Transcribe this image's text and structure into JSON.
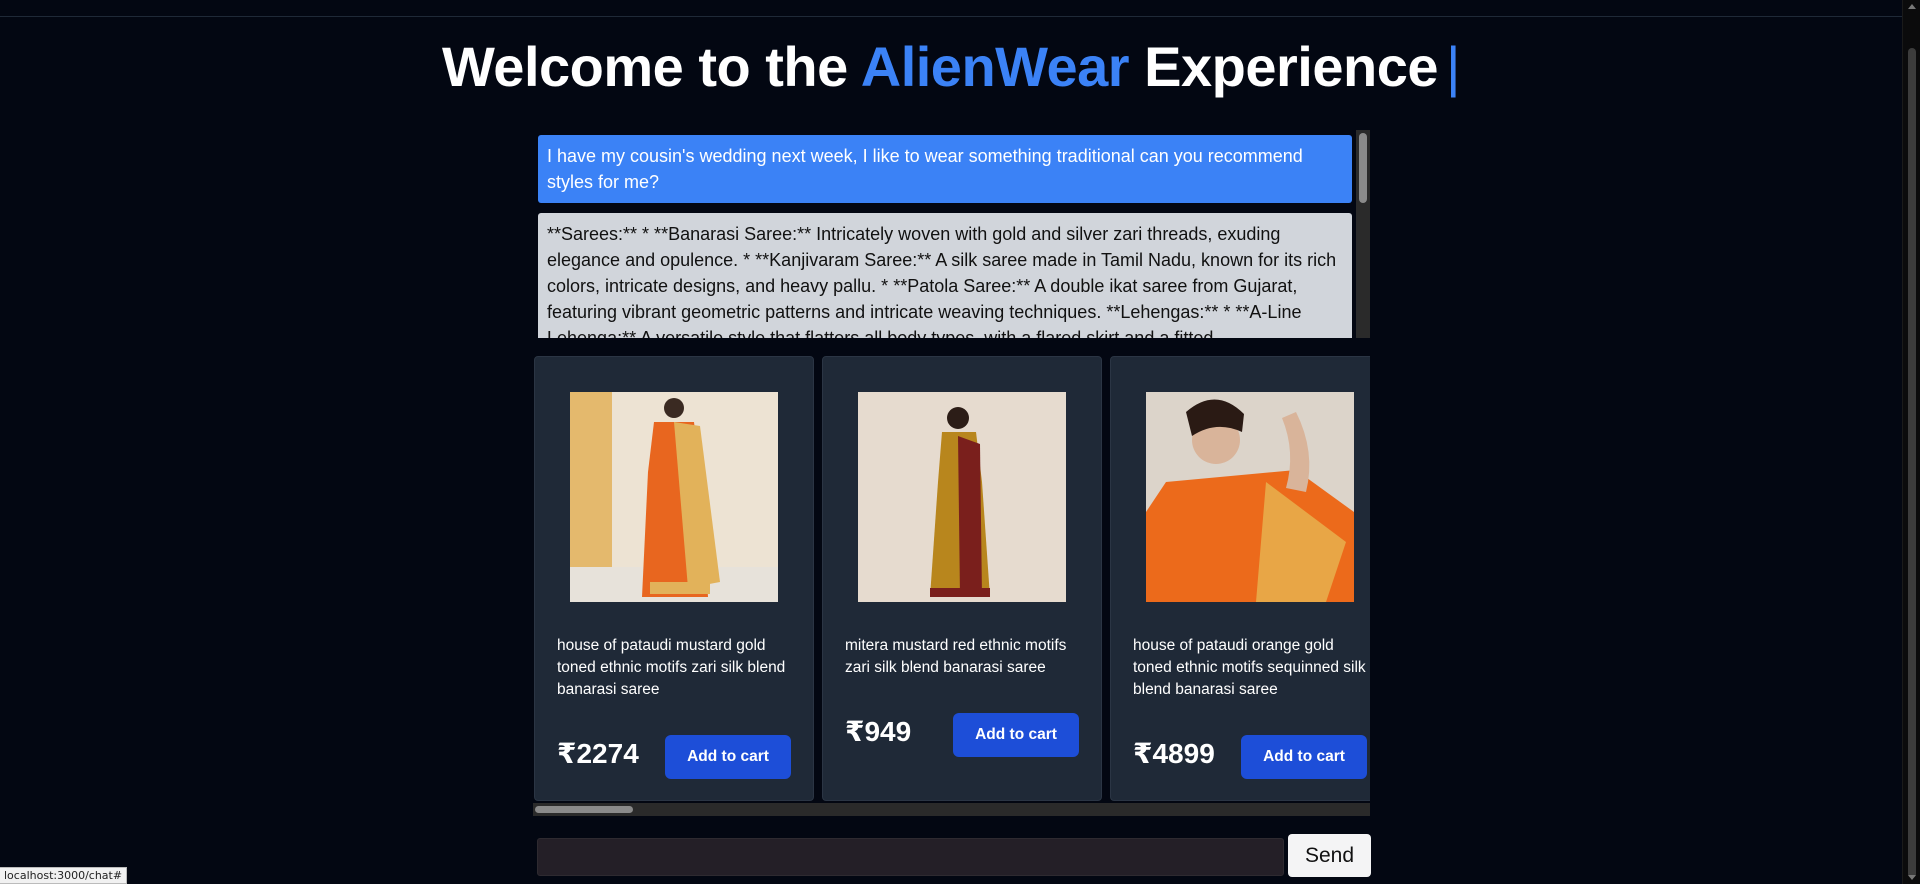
{
  "headline": {
    "prefix": "Welcome to the ",
    "brand": "AlienWear",
    "suffix": " Experience",
    "cursor": "|"
  },
  "chat": {
    "messages": [
      {
        "role": "user",
        "text": "I have my cousin's wedding next week, I like to wear something traditional can you recommend styles for me?"
      },
      {
        "role": "assistant",
        "text": "**Sarees:** * **Banarasi Saree:** Intricately woven with gold and silver zari threads, exuding elegance and opulence. * **Kanjivaram Saree:** A silk saree made in Tamil Nadu, known for its rich colors, intricate designs, and heavy pallu. * **Patola Saree:** A double ikat saree from Gujarat, featuring vibrant geometric patterns and intricate weaving techniques. **Lehengas:** * **A-Line Lehenga:** A versatile style that flatters all body types, with a flared skirt and a fitted"
      }
    ]
  },
  "products": [
    {
      "name": "house of pataudi mustard gold toned ethnic motifs zari silk blend banarasi saree",
      "price": "₹2274",
      "cart_label": "Add to cart",
      "colors": {
        "bg": "#ede3d3",
        "garment": "#e8661f",
        "accent": "#e2b25a"
      }
    },
    {
      "name": "mitera mustard red ethnic motifs zari silk blend banarasi saree",
      "price": "₹949",
      "cart_label": "Add to cart",
      "colors": {
        "bg": "#e6dbcf",
        "garment": "#b8861d",
        "accent": "#7a1f1c"
      }
    },
    {
      "name": "house of pataudi orange gold toned ethnic motifs sequinned silk blend banarasi saree",
      "price": "₹4899",
      "cart_label": "Add to cart",
      "colors": {
        "bg": "#dcd4ca",
        "garment": "#ec6a1b",
        "accent": "#e8b04e"
      }
    }
  ],
  "composer": {
    "value": "",
    "placeholder": "",
    "send_label": "Send"
  },
  "status_bar": {
    "url": "localhost:3000/chat#"
  },
  "theme": {
    "background": "#030712",
    "accent": "#3b82f6",
    "button": "#1d4ed8",
    "card": "#1f2937"
  }
}
